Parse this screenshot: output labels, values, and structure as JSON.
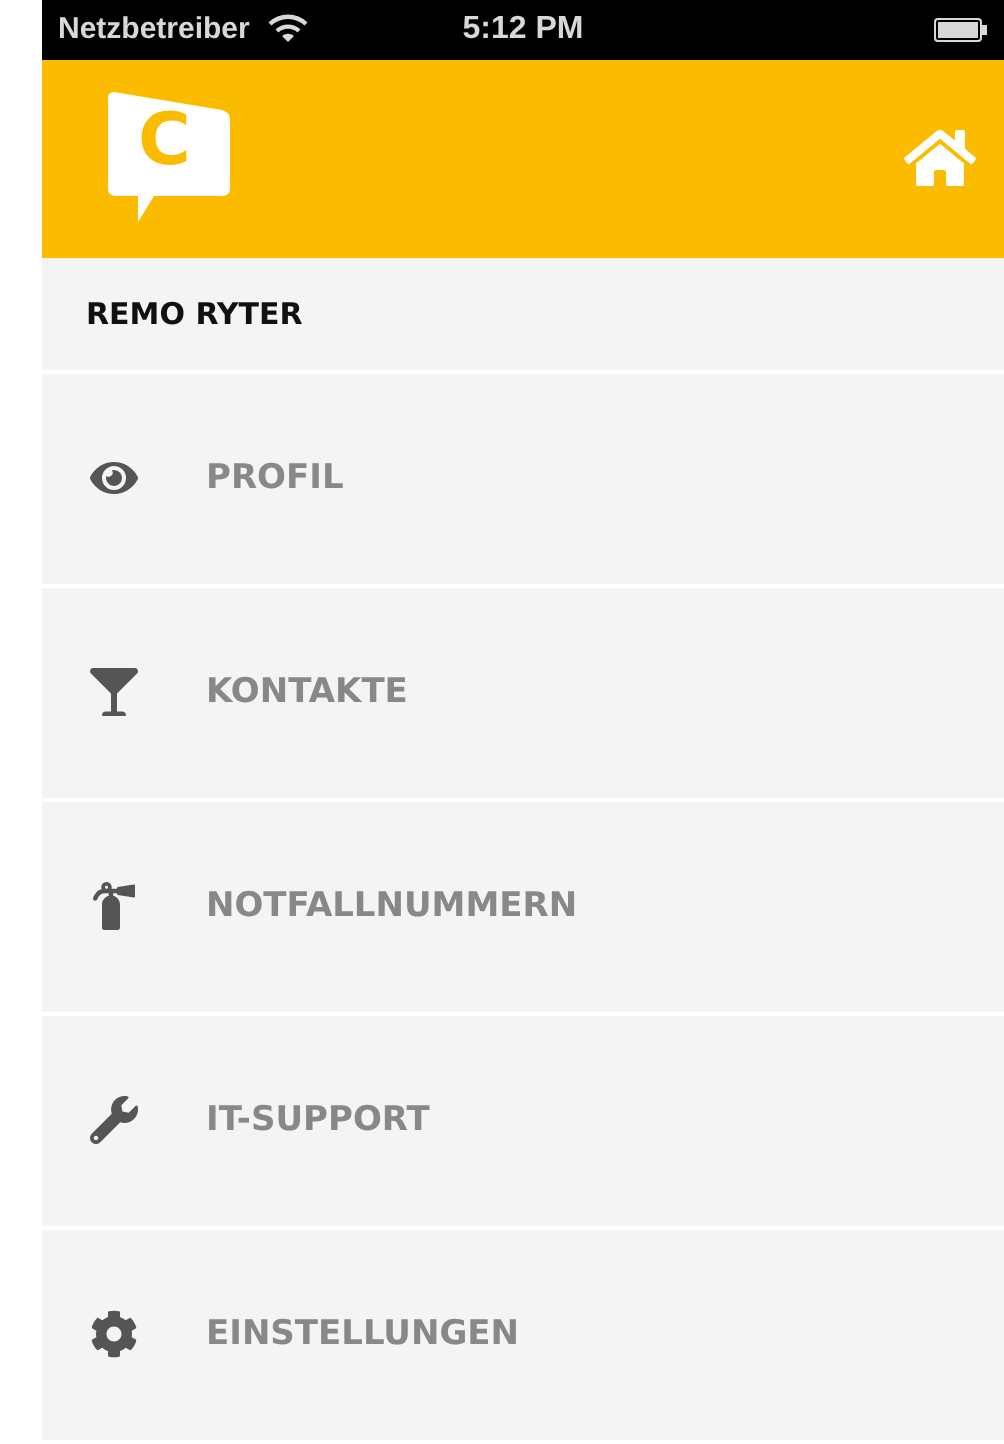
{
  "status_bar": {
    "carrier": "Netzbetreiber",
    "time": "5:12 PM"
  },
  "header": {
    "logo_letter": "C"
  },
  "user": {
    "name": "REMO RYTER"
  },
  "menu": [
    {
      "label": "PROFIL"
    },
    {
      "label": "KONTAKTE"
    },
    {
      "label": "NOTFALLNUMMERN"
    },
    {
      "label": "IT-SUPPORT"
    },
    {
      "label": "EINSTELLUNGEN"
    }
  ]
}
